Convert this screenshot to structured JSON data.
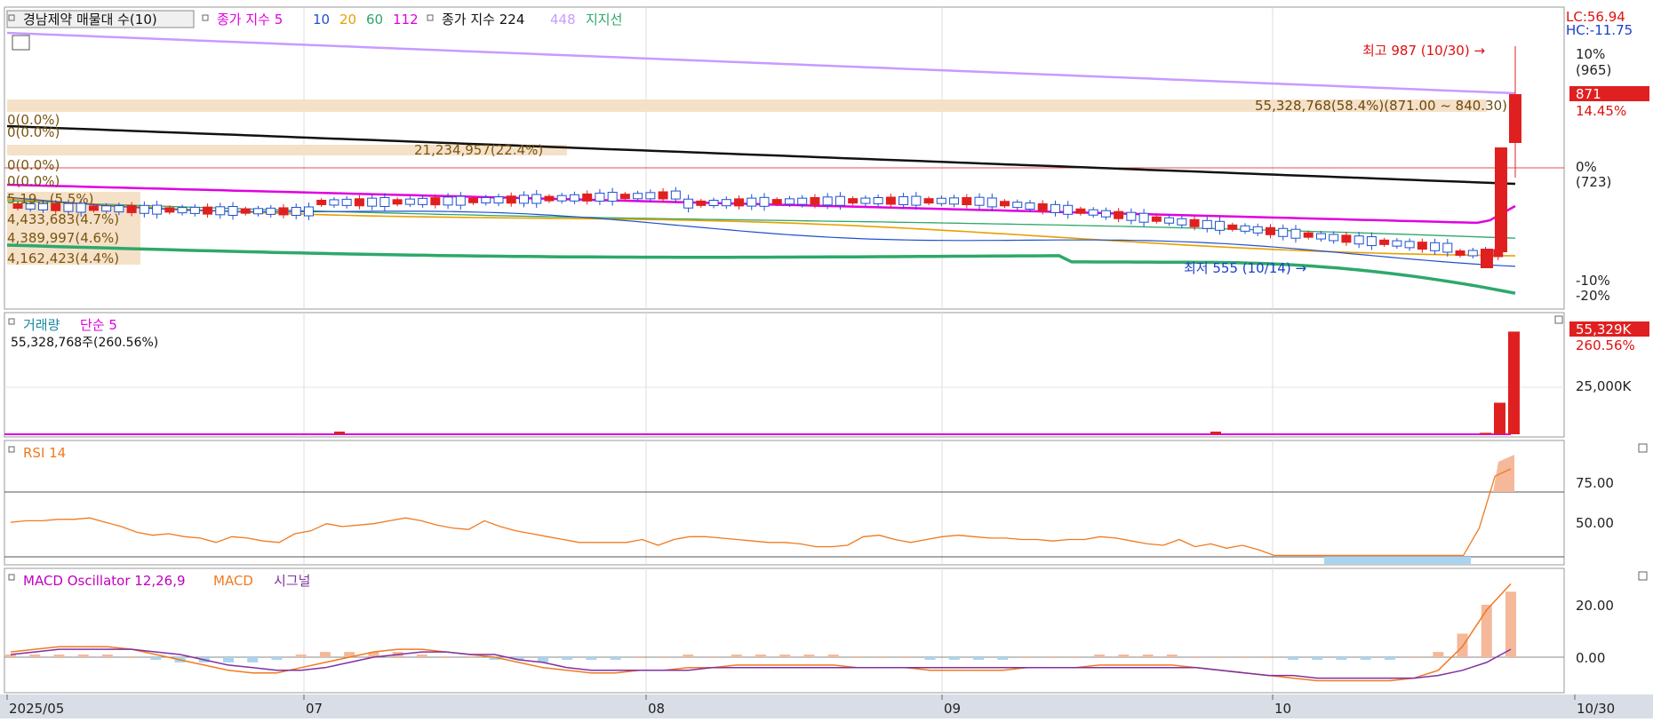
{
  "chart_data": [
    {
      "type": "candlestick",
      "legend": {
        "title": "경남제약 매물대 수(10)",
        "ma_label": "종가 지수",
        "ma_periods": [
          "5",
          "10",
          "20",
          "60",
          "112"
        ],
        "ma_colors": [
          "#e040e0",
          "#1e50d0",
          "#e8a000",
          "#2ea86a",
          "#e000e0"
        ],
        "ma2_label": "종가 지수",
        "ma2_periods": [
          "224",
          "448"
        ],
        "ma2_colors": [
          "#111111",
          "#c79bff"
        ],
        "support_label": "지지선",
        "support_color": "#2ea86a"
      },
      "x_ticks": [
        "2025/05",
        "07",
        "08",
        "09",
        "10",
        "10/30"
      ],
      "y_right_labels": [
        "10%",
        "(965)",
        "0%",
        "(723)",
        "-10%",
        "-20%"
      ],
      "last_price": "871",
      "last_change": "14.45%",
      "lc_label": "LC:56.94",
      "hc_label": "HC:-11.75",
      "high_note": "최고 987 (10/30) →",
      "low_note": "최저 555 (10/14) →",
      "volume_profile": [
        "55,328,768(58.4%)(871.00 ~ 840.30)",
        "21,234,957(22.4%)",
        "0(0.0%)",
        "0(0.0%)",
        "0(0.0%)",
        "0(0.0%)",
        "5,19...(5.5%)",
        "4,433,683(4.7%)",
        "4,389,997(4.6%)",
        "4,162,423(4.4%)"
      ],
      "ohlc_approx": {
        "start_close": 610,
        "july_high": 650,
        "oct_low": 555,
        "oct28_close": 700,
        "oct30_high": 987,
        "oct30_close": 871
      }
    },
    {
      "type": "bar",
      "title": "거래량",
      "ma_label": "단순 5",
      "value_label": "55,328,768주(260.56%)",
      "right_badge": "55,329K",
      "right_pct": "260.56%",
      "y_ticks": [
        "25,000K"
      ],
      "last_values_k": [
        800,
        17000,
        55329
      ]
    },
    {
      "type": "line",
      "title": "RSI 14",
      "y_ticks": [
        "75.00",
        "50.00"
      ],
      "values": [
        54,
        55,
        55,
        56,
        56,
        57,
        54,
        51,
        47,
        45,
        46,
        44,
        43,
        40,
        44,
        43,
        41,
        40,
        46,
        48,
        53,
        51,
        52,
        53,
        55,
        57,
        55,
        52,
        50,
        49,
        55,
        51,
        48,
        46,
        44,
        42,
        40,
        40,
        40,
        40,
        42,
        38,
        42,
        44,
        44,
        43,
        42,
        41,
        40,
        40,
        39,
        37,
        37,
        38,
        44,
        45,
        42,
        40,
        42,
        44,
        45,
        44,
        43,
        43,
        42,
        42,
        41,
        42,
        42,
        44,
        43,
        41,
        39,
        38,
        42,
        37,
        39,
        36,
        38,
        35,
        31,
        31,
        31,
        31,
        31,
        31,
        31,
        31,
        31,
        31,
        31,
        31,
        31,
        50,
        86,
        91
      ]
    },
    {
      "type": "line",
      "title": "MACD Oscillator 12,26,9",
      "macd_label": "MACD",
      "signal_label": "시그널",
      "y_ticks": [
        "20.00",
        "0.00"
      ],
      "macd": [
        2,
        3,
        4,
        4,
        4,
        3,
        1,
        -1,
        -3,
        -5,
        -6,
        -6,
        -4,
        -2,
        0,
        2,
        3,
        3,
        2,
        1,
        0,
        -2,
        -4,
        -5,
        -6,
        -6,
        -5,
        -5,
        -4,
        -4,
        -3,
        -3,
        -3,
        -3,
        -3,
        -4,
        -4,
        -4,
        -5,
        -5,
        -5,
        -5,
        -4,
        -4,
        -4,
        -3,
        -3,
        -3,
        -3,
        -4,
        -5,
        -6,
        -7,
        -8,
        -9,
        -9,
        -9,
        -9,
        -8,
        -5,
        4,
        18,
        28
      ],
      "signal": [
        1,
        2,
        3,
        3,
        3,
        3,
        2,
        1,
        -1,
        -3,
        -4,
        -5,
        -5,
        -4,
        -2,
        0,
        1,
        2,
        2,
        1,
        1,
        -1,
        -2,
        -4,
        -5,
        -5,
        -5,
        -5,
        -5,
        -4,
        -4,
        -4,
        -4,
        -4,
        -4,
        -4,
        -4,
        -4,
        -4,
        -4,
        -4,
        -4,
        -4,
        -4,
        -4,
        -4,
        -4,
        -4,
        -4,
        -4,
        -5,
        -6,
        -7,
        -7,
        -8,
        -8,
        -8,
        -8,
        -8,
        -7,
        -5,
        -2,
        3
      ],
      "osc": [
        1,
        1,
        1,
        1,
        1,
        0,
        -1,
        -2,
        -2,
        -2,
        -2,
        -1,
        1,
        2,
        2,
        2,
        2,
        1,
        0,
        0,
        -1,
        -1,
        -2,
        -1,
        -1,
        -1,
        0,
        0,
        1,
        0,
        1,
        1,
        1,
        1,
        1,
        0,
        0,
        0,
        -1,
        -1,
        -1,
        -1,
        0,
        0,
        0,
        1,
        1,
        1,
        1,
        0,
        0,
        0,
        0,
        -1,
        -1,
        -1,
        -1,
        -1,
        0,
        2,
        9,
        20,
        25
      ]
    }
  ]
}
